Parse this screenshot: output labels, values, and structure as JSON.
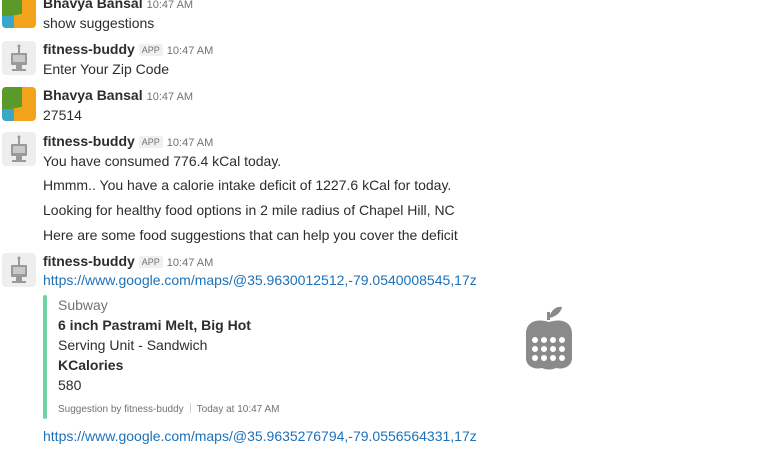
{
  "messages": [
    {
      "sender": "Bhavya Bansal",
      "time": "10:47 AM",
      "lines": [
        "show suggestions"
      ]
    },
    {
      "sender": "fitness-buddy",
      "badge": "APP",
      "time": "10:47 AM",
      "lines": [
        "Enter Your Zip Code"
      ]
    },
    {
      "sender": "Bhavya Bansal",
      "time": "10:47 AM",
      "lines": [
        "27514"
      ]
    },
    {
      "sender": "fitness-buddy",
      "badge": "APP",
      "time": "10:47 AM",
      "lines": [
        "You have consumed 776.4 kCal today.",
        "Hmmm.. You have a calorie intake deficit of 1227.6 kCal for today.",
        "Looking for healthy food options in 2 mile radius of Chapel Hill, NC",
        "Here are some food suggestions that can help you cover the deficit"
      ]
    },
    {
      "sender": "fitness-buddy",
      "badge": "APP",
      "time": "10:47 AM",
      "link": "https://www.google.com/maps/@35.9630012512,-79.0540008545,17z",
      "attachment": {
        "provider": "Subway",
        "title": "6 inch Pastrami Melt, Big Hot",
        "serving": "Serving Unit - Sandwich",
        "field_title": "KCalories",
        "field_value": "580",
        "footer_source": "Suggestion by fitness-buddy",
        "footer_time": "Today at 10:47 AM",
        "thumb_icon": "apple-calculator-icon"
      },
      "link2": "https://www.google.com/maps/@35.9635276794,-79.0556564331,17z"
    }
  ],
  "colors": {
    "link": "#1d71b8",
    "attachment_bar": "#6fd3a4",
    "muted": "#717274"
  }
}
